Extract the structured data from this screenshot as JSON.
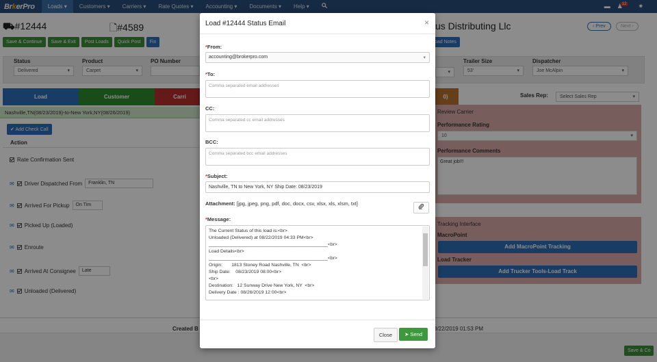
{
  "nav": {
    "brand_a": "Br",
    "brand_b": "k",
    "brand_c": "erPro",
    "items": [
      "Loads ▾",
      "Customers ▾",
      "Carriers ▾",
      "Rate Quotes ▾",
      "Accounting ▾",
      "Documents ▾",
      "Help ▾"
    ],
    "search_icon": "🔍",
    "notif_count": "12"
  },
  "header": {
    "load_id": "#12444",
    "doc_id": "#4589",
    "customer": "us Distributing Llc",
    "prev": "‹ Prev",
    "next": "Next ›"
  },
  "toolbar": {
    "save_continue": "Save & Continue",
    "save_exit": "Save & Exit",
    "post_loads": "Post Loads",
    "quick_post": "Quick Post",
    "find": "Fin",
    "load_notes": "oad Notes"
  },
  "fields": {
    "status_label": "Status",
    "status_value": "Delivered",
    "product_label": "Product",
    "product_value": "Carpet",
    "po_label": "PO Number",
    "trailer_label": "Trailer Size",
    "trailer_value": "53'",
    "dispatcher_label": "Dispatcher",
    "dispatcher_value": "Joe McAlpin",
    "sales_rep_label": "Sales Rep:",
    "sales_rep_value": "Select Sales Rep"
  },
  "tabs": [
    "Load",
    "Customer",
    "Carri",
    "0)"
  ],
  "route": "Nashville,TN(08/23/2019)-to-New York,NY(08/26/2019)",
  "add_check_call": "Add Check Call",
  "action_header": "Action",
  "actions": [
    {
      "label": "Rate Confirmation Sent",
      "extra": ""
    },
    {
      "label": "Driver Dispatched From",
      "extra": "Franklin, TN"
    },
    {
      "label": "Arrived For Pickup",
      "extra": "On Tim"
    },
    {
      "label": "Picked Up (Loaded)",
      "extra": ""
    },
    {
      "label": "Enroute",
      "extra": ""
    },
    {
      "label": "Arrived At Consignee",
      "extra": "Late"
    },
    {
      "label": "Unloaded (Delivered)",
      "extra": ""
    }
  ],
  "created_by": "Created B",
  "created_date": "8/22/2019 01:53 PM",
  "save_bottom": "Save & Co",
  "review": {
    "title": "Review Carrier",
    "rating_label": "Performance Rating",
    "rating_value": "10",
    "comments_label": "Performance Comments",
    "comments_value": "Great job!!!"
  },
  "tracking": {
    "title": "Tracking Interface",
    "macropoint_label": "MacroPoint",
    "macropoint_btn": "Add MacroPoint Tracking",
    "tracker_label": "Load Tracker",
    "tracker_btn": "Add Trucker Tools-Load Track"
  },
  "modal": {
    "title": "Load #12444 Status Email",
    "close_x": "×",
    "from_label": "From:",
    "from_value": "accounting@brokerpro.com",
    "to_label": "To:",
    "to_placeholder": "Comma separated email addresses",
    "cc_label": "CC:",
    "cc_placeholder": "Comma separated cc email addresses",
    "bcc_label": "BCC:",
    "bcc_placeholder": "Comma separated bcc email addresses",
    "subject_label": "Subject:",
    "subject_value": "Nashville, TN to New York, NY Ship Date: 08/23/2019",
    "attachment_label": "Attachment:",
    "attachment_types": "[jpg, jpeg, png, pdf, doc, docx, csv, xlsx, xls, xlsm, txt]",
    "message_label": "Message:",
    "message_lines": [
      "The Current Status of this load is:<br>",
      "Unloaded (Delivered)  at 08/22/2019 04:33 PM<br>",
      "______________________________________________<br>",
      "Load Details<br>",
      "______________________________________________<br>",
      "Origin:       1813 Stoney Road Nashville, TN  <br>",
      "Ship Date:    08/23/2019 08:00<br>",
      "<br>",
      "Destination:   12 Sunway Drive New York, NY  <br>",
      "Delivery Date : 08/26/2019 12:00<br>"
    ],
    "close_btn": "Close",
    "send_btn": "Send"
  }
}
